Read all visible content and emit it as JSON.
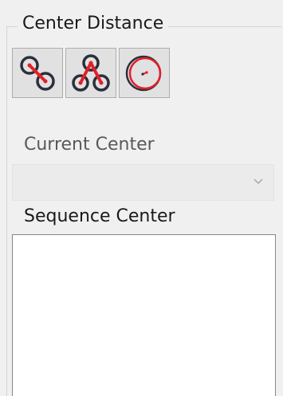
{
  "group": {
    "title": "Center Distance"
  },
  "tools": [
    {
      "name": "point-to-point-distance-icon"
    },
    {
      "name": "three-point-distance-icon"
    },
    {
      "name": "concentric-circles-icon"
    }
  ],
  "current_center": {
    "label": "Current Center",
    "value": ""
  },
  "sequence_center": {
    "label": "Sequence Center",
    "items": []
  },
  "colors": {
    "accent": "#e0202a",
    "icon_stroke": "#2b2f3a"
  }
}
